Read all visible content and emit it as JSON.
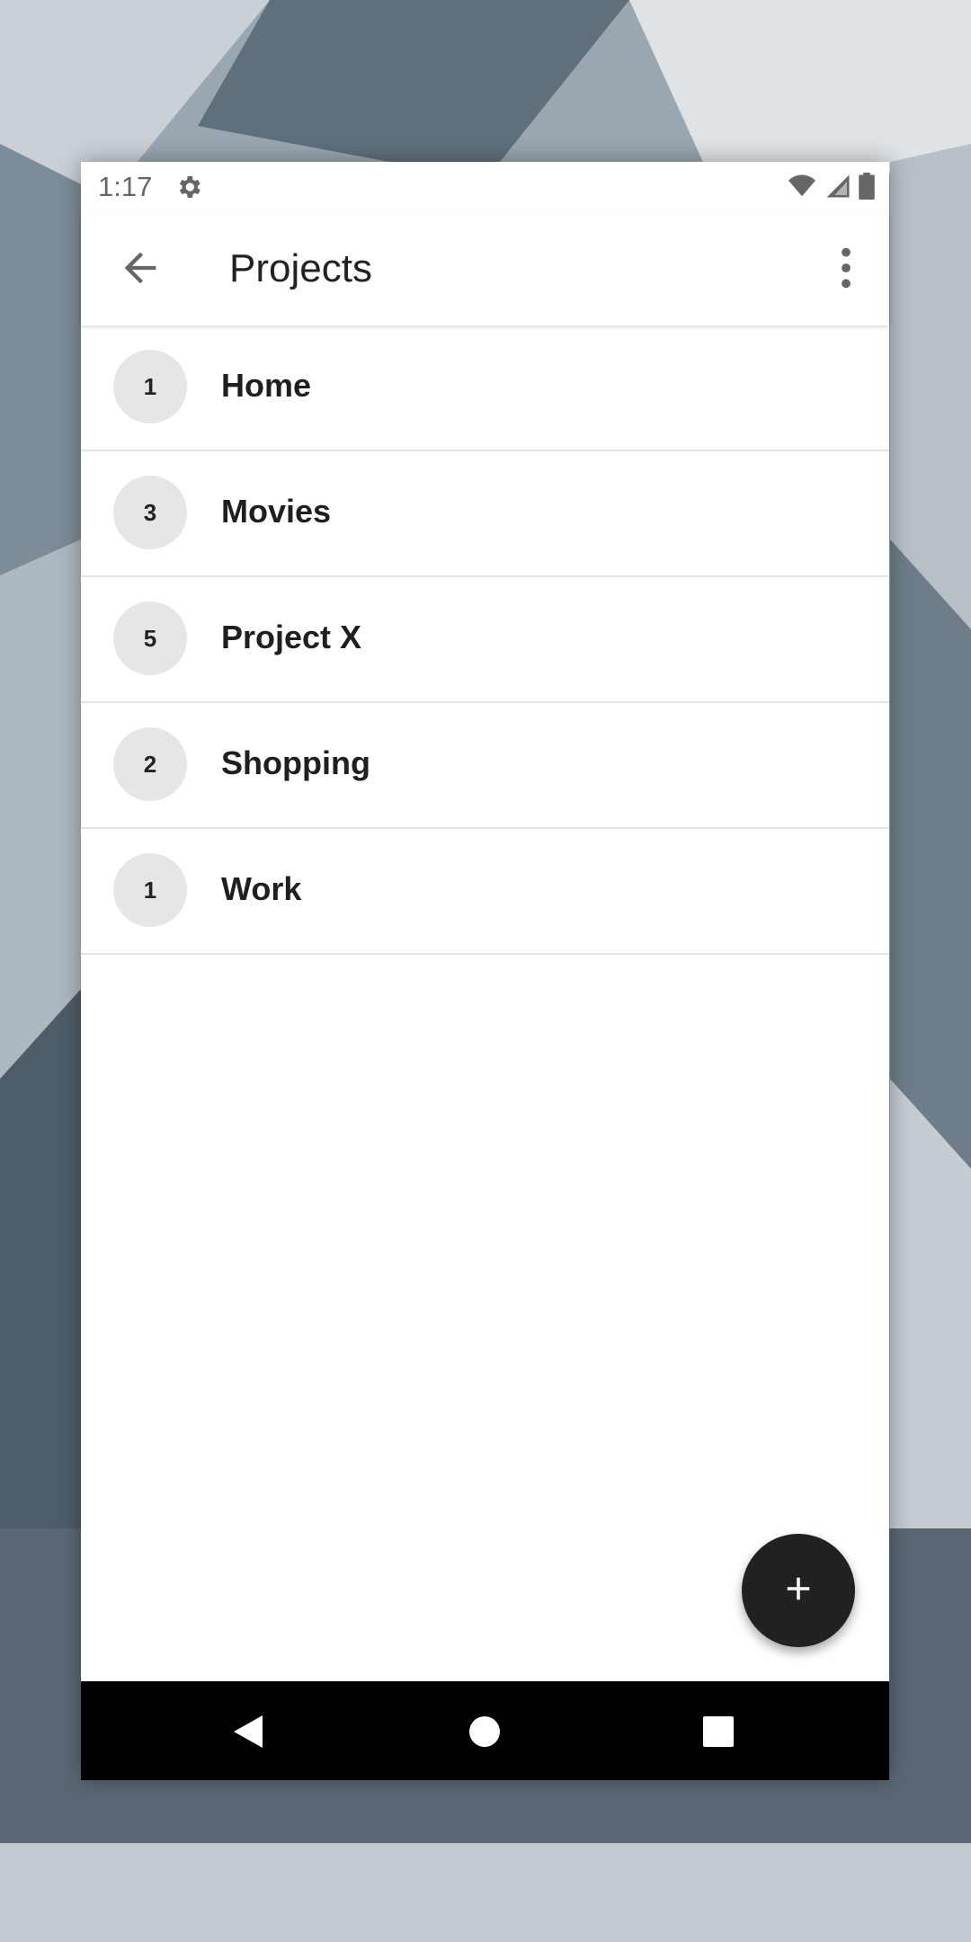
{
  "status_bar": {
    "time": "1:17",
    "icons": [
      "settings-icon",
      "wifi-icon",
      "signal-icon",
      "battery-icon"
    ]
  },
  "app_bar": {
    "title": "Projects",
    "back_icon": "arrow-back-icon",
    "menu_icon": "more-vert-icon"
  },
  "projects": [
    {
      "count": "1",
      "name": "Home"
    },
    {
      "count": "3",
      "name": "Movies"
    },
    {
      "count": "5",
      "name": "Project X"
    },
    {
      "count": "2",
      "name": "Shopping"
    },
    {
      "count": "1",
      "name": "Work"
    }
  ],
  "fab": {
    "icon": "add-icon"
  },
  "nav_bar": {
    "icons": [
      "back-triangle-icon",
      "home-circle-icon",
      "recents-square-icon"
    ]
  },
  "colors": {
    "fab": "#212121",
    "badge": "#e6e6e6",
    "nav": "#000000"
  }
}
